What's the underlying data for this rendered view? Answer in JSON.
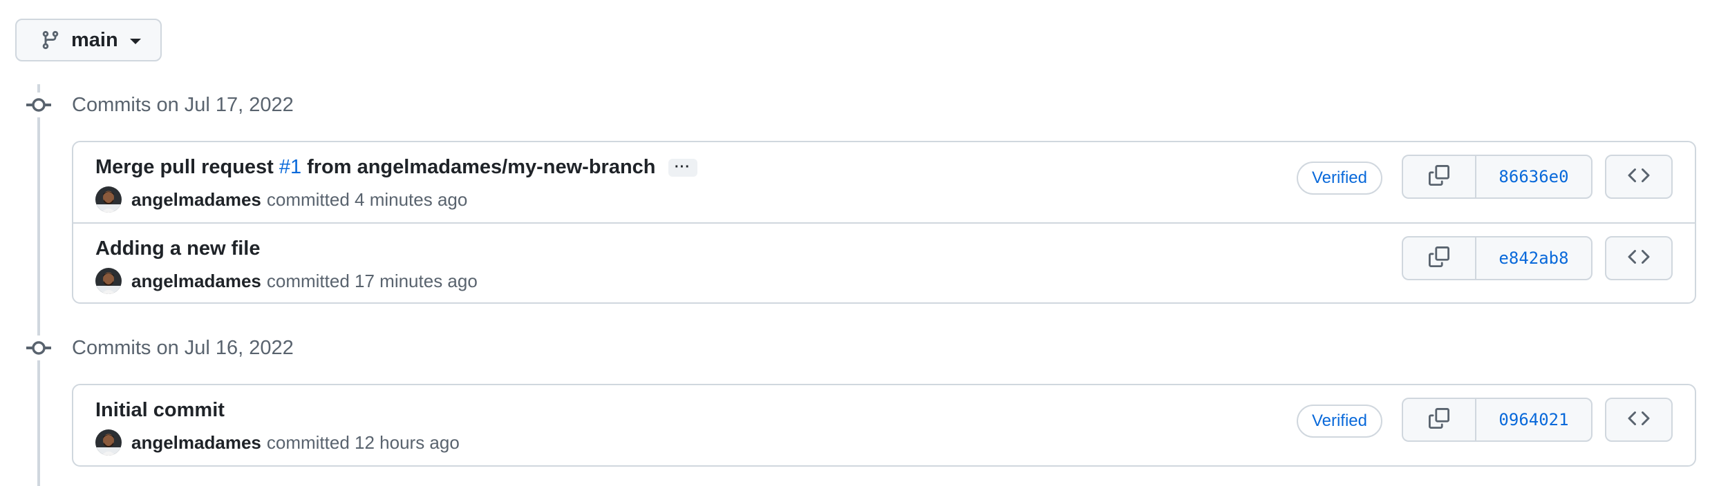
{
  "branch": {
    "name": "main"
  },
  "groups": [
    {
      "title": "Commits on Jul 17, 2022",
      "commits": [
        {
          "title_prefix": "Merge pull request",
          "pr_number": "#1",
          "title_suffix": "from angelmadames/my-new-branch",
          "ellipsis": "···",
          "author": "angelmadames",
          "committed_text": "committed 4 minutes ago",
          "verified": "Verified",
          "sha": "86636e0"
        },
        {
          "title": "Adding a new file",
          "author": "angelmadames",
          "committed_text": "committed 17 minutes ago",
          "sha": "e842ab8"
        }
      ]
    },
    {
      "title": "Commits on Jul 16, 2022",
      "commits": [
        {
          "title": "Initial commit",
          "author": "angelmadames",
          "committed_text": "committed 12 hours ago",
          "verified": "Verified",
          "sha": "0964021"
        }
      ]
    }
  ],
  "icons": {
    "branch": "git-branch-icon",
    "commit_node": "git-commit-icon",
    "copy": "copy-icon",
    "browse": "code-icon",
    "caret": "triangle-down-icon"
  },
  "colors": {
    "link": "#0969da",
    "border": "#d0d7de",
    "muted": "#59636e",
    "button_bg": "#f6f8fa"
  }
}
